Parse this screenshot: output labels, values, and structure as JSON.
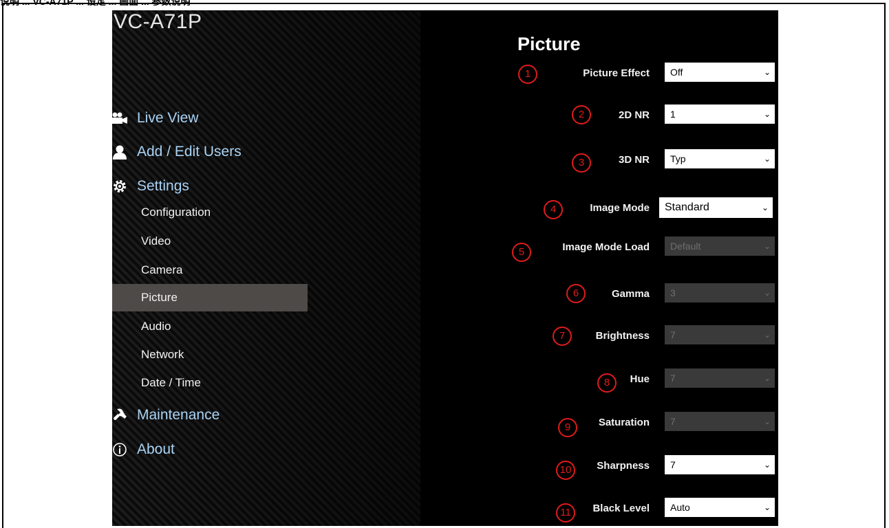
{
  "doc_heading": "说明 ... VC-A71P ... 设定 ... 画面 ... 参数说明",
  "app": {
    "title": "VC-A71P"
  },
  "nav": {
    "main": [
      {
        "label": "Live View",
        "icon": "camera-icon"
      },
      {
        "label": "Add / Edit Users",
        "icon": "user-icon"
      },
      {
        "label": "Settings",
        "icon": "gear-icon"
      },
      {
        "label": "Maintenance",
        "icon": "wrench-icon"
      },
      {
        "label": "About",
        "icon": "info-icon"
      }
    ],
    "settings_sub": [
      {
        "label": "Configuration"
      },
      {
        "label": "Video"
      },
      {
        "label": "Camera"
      },
      {
        "label": "Picture",
        "active": true
      },
      {
        "label": "Audio"
      },
      {
        "label": "Network"
      },
      {
        "label": "Date / Time"
      }
    ]
  },
  "page": {
    "title": "Picture",
    "fields": [
      {
        "marker": "1",
        "label": "Picture Effect",
        "value": "Off",
        "enabled": true
      },
      {
        "marker": "2",
        "label": "2D NR",
        "value": "1",
        "enabled": true
      },
      {
        "marker": "3",
        "label": "3D NR",
        "value": "Typ",
        "enabled": true
      },
      {
        "marker": "4",
        "label": "Image Mode",
        "value": "Standard",
        "enabled": true
      },
      {
        "marker": "5",
        "label": "Image Mode Load",
        "value": "Default",
        "enabled": false
      },
      {
        "marker": "6",
        "label": "Gamma",
        "value": "3",
        "enabled": false
      },
      {
        "marker": "7",
        "label": "Brightness",
        "value": "7",
        "enabled": false
      },
      {
        "marker": "8",
        "label": "Hue",
        "value": "7",
        "enabled": false
      },
      {
        "marker": "9",
        "label": "Saturation",
        "value": "7",
        "enabled": false
      },
      {
        "marker": "10",
        "label": "Sharpness",
        "value": "7",
        "enabled": true
      },
      {
        "marker": "11",
        "label": "Black Level",
        "value": "Auto",
        "enabled": true
      }
    ]
  },
  "colors": {
    "nav_link": "#a9d3f5",
    "marker_red": "#e01b1b",
    "active_bg": "#4d4a48"
  }
}
